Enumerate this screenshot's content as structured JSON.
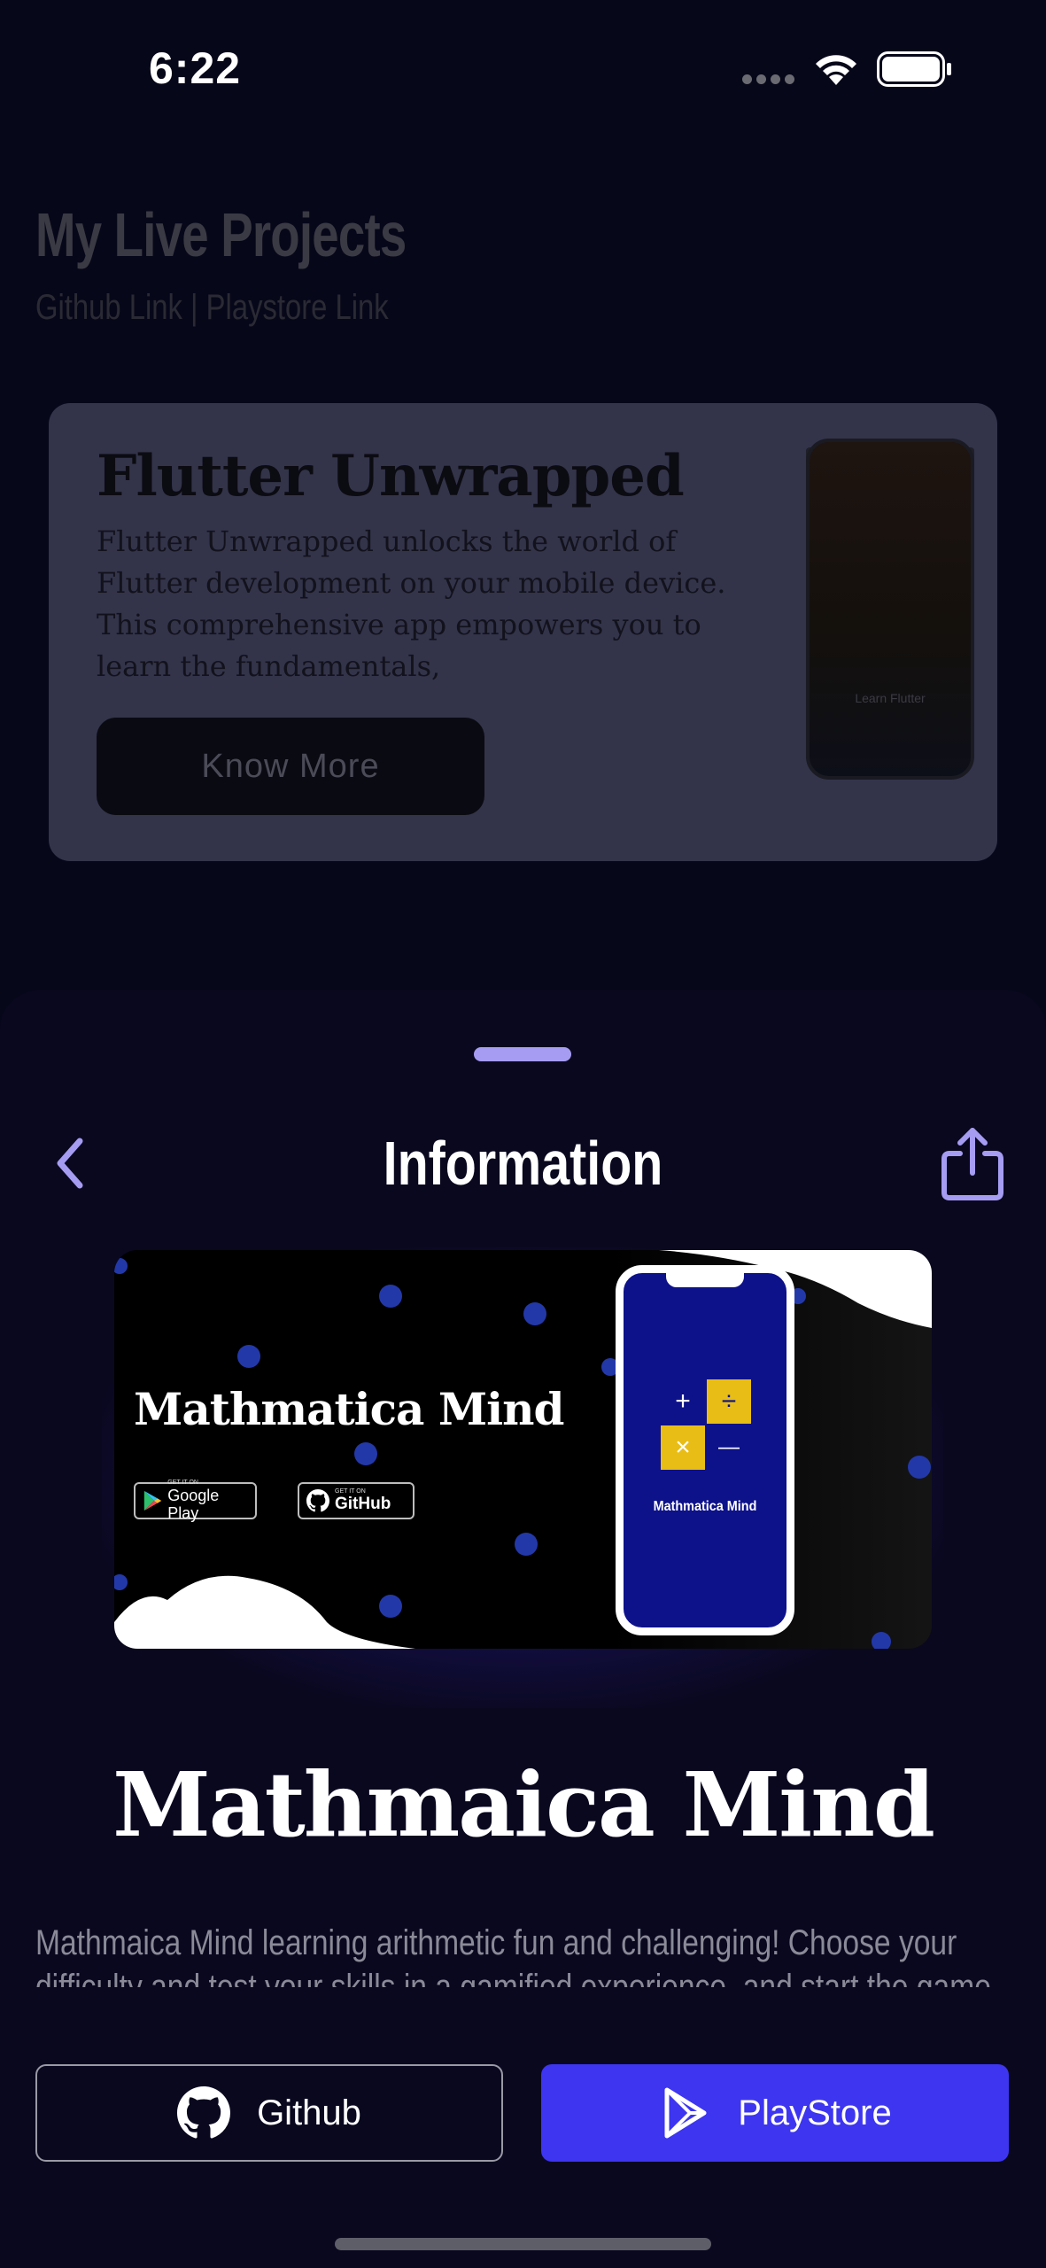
{
  "status_bar": {
    "time": "6:22"
  },
  "background_page": {
    "title": "My Live Projects",
    "subtitle": "Github Link | Playstore Link",
    "card": {
      "title": "Flutter Unwrapped",
      "description": "Flutter Unwrapped unlocks the world of Flutter development on your mobile device. This comprehensive app empowers you to learn the fundamentals,",
      "button_label": "Know More",
      "phone_caption": "Learn Flutter"
    }
  },
  "sheet": {
    "title": "Information",
    "banner": {
      "title": "Mathmatica Mind",
      "google_play_small": "GET IT ON",
      "google_play_big": "Google Play",
      "github_small": "GET IT ON",
      "github_big": "GitHub",
      "phone_app_name": "Mathmatica Mind",
      "ops": [
        "+",
        "÷",
        "×",
        "—"
      ]
    },
    "app_name": "Mathmaica Mind",
    "description": "Mathmaica Mind learning arithmetic fun and challenging! Choose your difficulty and test your skills in a gamified experience, and start the game",
    "github_button": "Github",
    "playstore_button": "PlayStore"
  },
  "colors": {
    "accent": "#3d35f0",
    "handle": "#a69cf2",
    "sheet_bg": "#0a081f",
    "banner_yellow": "#e8bd16",
    "banner_blue": "#0d118a"
  }
}
